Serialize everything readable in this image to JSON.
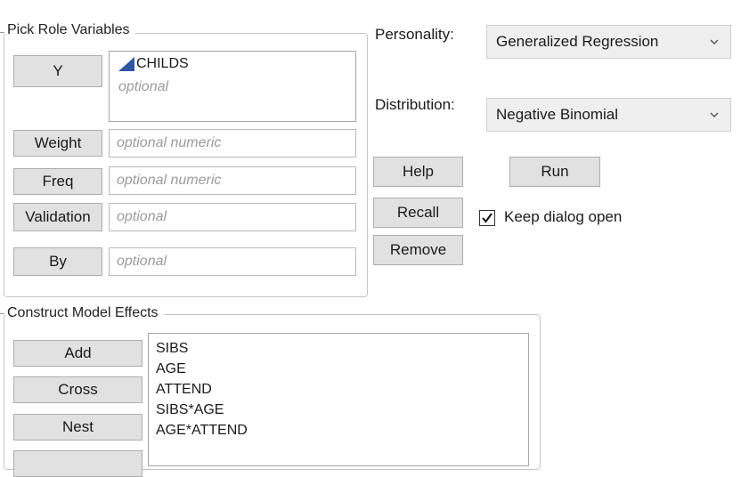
{
  "pick_role": {
    "title": "Pick Role Variables",
    "y_button": "Y",
    "y_variable": "CHILDS",
    "y_placeholder": "optional",
    "weight_button": "Weight",
    "weight_placeholder": "optional numeric",
    "freq_button": "Freq",
    "freq_placeholder": "optional numeric",
    "validation_button": "Validation",
    "validation_placeholder": "optional",
    "by_button": "By",
    "by_placeholder": "optional"
  },
  "personality": {
    "label": "Personality:",
    "value": "Generalized Regression"
  },
  "distribution": {
    "label": "Distribution:",
    "value": "Negative Binomial"
  },
  "actions": {
    "help": "Help",
    "run": "Run",
    "recall": "Recall",
    "remove": "Remove",
    "keep_open_label": "Keep dialog open",
    "keep_open_checked": true
  },
  "model_effects": {
    "title": "Construct Model Effects",
    "add": "Add",
    "cross": "Cross",
    "nest": "Nest",
    "effects": [
      "SIBS",
      "AGE",
      "ATTEND",
      "SIBS*AGE",
      "AGE*ATTEND"
    ]
  },
  "colors": {
    "continuous_icon": "#2f55a4"
  }
}
